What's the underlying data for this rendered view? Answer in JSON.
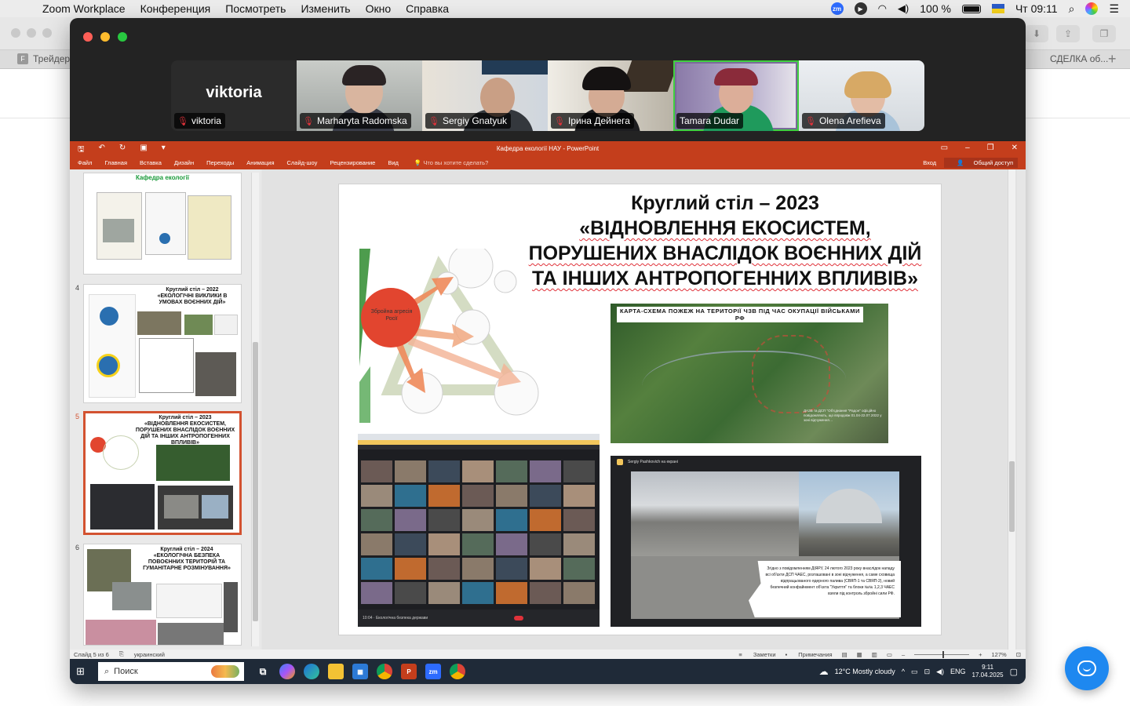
{
  "menubar": {
    "apple": "",
    "app_name": "Zoom Workplace",
    "menus": [
      "Конференция",
      "Посмотреть",
      "Изменить",
      "Окно",
      "Справка"
    ],
    "zoom_badge": "zm",
    "battery": "100 %",
    "clock": "Чт 09:11"
  },
  "browser": {
    "tab_left": "Трейдер",
    "tab_right": "СДЕЛКА об...",
    "plus": "+"
  },
  "zoom": {
    "participants": [
      {
        "name": "viktoria",
        "big_label": "viktoria"
      },
      {
        "name": "Marharyta Radomska"
      },
      {
        "name": "Sergiy Gnatyuk"
      },
      {
        "name": "Ірина Дейнега"
      },
      {
        "name": "Tamara Dudar",
        "active": true
      },
      {
        "name": "Olena Arefieva"
      }
    ]
  },
  "ppt": {
    "window_title": "Кафедра екології НАУ - PowerPoint",
    "ribbon_tabs": [
      "Файл",
      "Главная",
      "Вставка",
      "Дизайн",
      "Переходы",
      "Анимация",
      "Слайд-шоу",
      "Рецензирование",
      "Вид"
    ],
    "tell_me": "Что вы хотите сделать?",
    "sign_in": "Вход",
    "share": "Общий доступ",
    "thumbnails": [
      {
        "num": "",
        "title": "Кафедра екології"
      },
      {
        "num": "4",
        "title": "Круглий стіл – 2022\n«ЕКОЛОГІЧНІ ВИКЛИКИ В УМОВАХ ВОЄННИХ ДІЙ»"
      },
      {
        "num": "5",
        "title": "Круглий стіл – 2023\n«ВІДНОВЛЕННЯ ЕКОСИСТЕМ, ПОРУШЕНИХ ВНАСЛІДОК ВОЄННИХ ДІЙ ТА ІНШИХ АНТРОПОГЕННИХ ВПЛИВІВ»"
      },
      {
        "num": "6",
        "title": "Круглий стіл – 2024\n«ЕКОЛОГІЧНА БЕЗПЕКА ПОВОЄННИХ ТЕРИТОРІЙ ТА ГУМАНІТАРНЕ РОЗМІНУВАННЯ»"
      }
    ],
    "slide": {
      "title_line1": "Круглий стіл – 2023",
      "title_line2": "«ВІДНОВЛЕННЯ ЕКОСИСТЕМ,",
      "title_line3": "ПОРУШЕНИХ ВНАСЛІДОК ВОЄННИХ ДІЙ",
      "title_line4": "ТА ІНШИХ АНТРОПОГЕННИХ ВПЛИВІВ»",
      "diagram_center_label": "Збройна агресія Росії",
      "map_caption": "КАРТА-СХЕМА ПОЖЕЖ НА ТЕРИТОРІЇ ЧЗВ ПІД ЧАС ОКУПАЦІЇ ВІЙСЬКАМИ РФ",
      "map_note": "ДАЗВ та ДСП \"Об'єднання \"Радон\" офіційно повідомляють, що впродовж 01.04-22.07.2022 у зоні відчуження…",
      "video_header": "Sergiy Pashkovich на екрані",
      "video_caption": "Згідно з повідомленням ДІЯРУ, 24 лютого 2023 року внаслідок нападу всі об'єкти ДСП ЧАЕС, розташовані в зоні відчуження, а саме сховища відпрацьованого ядерного палива (СВЯП-1 та СВЯП-2), новий безпечний конфайнмент об'єкта \"Укриття\" та блоки №№ 1,2,3 ЧАЕС взяли під контроль збройні сили РФ.",
      "meeting_footer": "10:04 · Екологічна безпека держави"
    },
    "status": {
      "slide_info": "Слайд 5 из 6",
      "language": "украинский",
      "notes": "Заметки",
      "comments": "Примечания",
      "zoom": "127%"
    }
  },
  "taskbar": {
    "search_placeholder": "Поиск",
    "weather": "12°C  Mostly cloudy",
    "lang": "ENG",
    "time": "9:11",
    "date": "17.04.2025"
  }
}
